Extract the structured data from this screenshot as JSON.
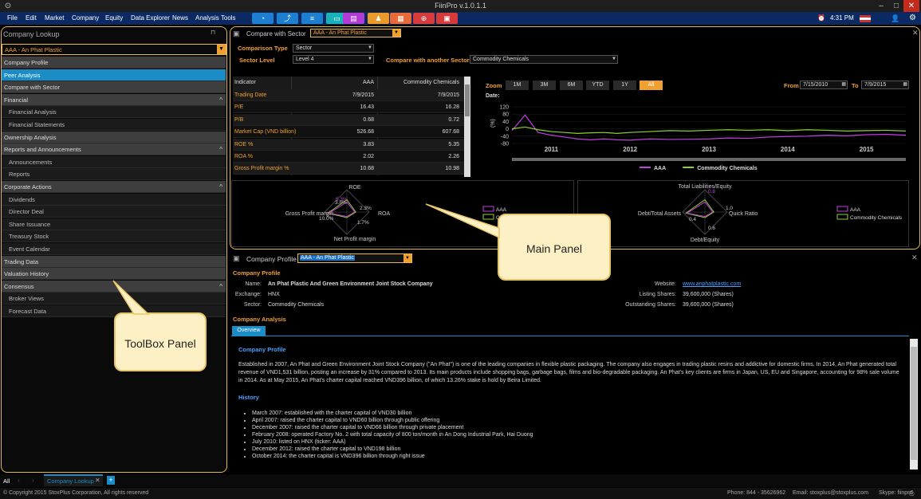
{
  "window": {
    "title": "FiinPro v.1.0.1.1",
    "time": "4:31 PM"
  },
  "menu": [
    "File",
    "Edit",
    "Market",
    "Company",
    "Equity",
    "Data Explorer",
    "News",
    "Analysis Tools"
  ],
  "toolbar_icons": [
    "dashboard-icon",
    "chart-icon",
    "screener-icon",
    "monitor-icon",
    "report-icon",
    "group-icon",
    "presentation-icon",
    "help-icon",
    "calendar-icon"
  ],
  "toolbox": {
    "title": "Company Lookup",
    "selected": "AAA - An Phat Plastic",
    "items": [
      {
        "label": "Company Profile",
        "kind": "cat"
      },
      {
        "label": "Peer Analysis",
        "kind": "active"
      },
      {
        "label": "Compare with Sector",
        "kind": "cat"
      },
      {
        "label": "Financial",
        "kind": "cat",
        "chev": "^"
      },
      {
        "label": "Financial Analysis",
        "kind": "sub"
      },
      {
        "label": "Financial Statements",
        "kind": "sub"
      },
      {
        "label": "Ownership Analysis",
        "kind": "cat"
      },
      {
        "label": "Reports and Announcements",
        "kind": "cat",
        "chev": "^"
      },
      {
        "label": "Announcements",
        "kind": "sub"
      },
      {
        "label": "Reports",
        "kind": "sub"
      },
      {
        "label": "Corporate Actions",
        "kind": "cat",
        "chev": "^"
      },
      {
        "label": "Dividends",
        "kind": "sub"
      },
      {
        "label": "Director Deal",
        "kind": "sub"
      },
      {
        "label": "Share Issuance",
        "kind": "sub"
      },
      {
        "label": "Treasury Stock",
        "kind": "sub"
      },
      {
        "label": "Event Calendar",
        "kind": "sub"
      },
      {
        "label": "Trading Data",
        "kind": "cat"
      },
      {
        "label": "Valuation History",
        "kind": "cat"
      },
      {
        "label": "Consensus",
        "kind": "cat",
        "chev": "^"
      },
      {
        "label": "Broker Views",
        "kind": "sub"
      },
      {
        "label": "Forecast Data",
        "kind": "sub"
      }
    ]
  },
  "compare": {
    "title": "Compare with Sector",
    "selected": "AAA - An Phat Plastic",
    "comparison_type_label": "Comparison Type",
    "comparison_type": "Sector",
    "sector_level_label": "Sector Level",
    "sector_level": "Level 4",
    "compare_another_label": "Compare with another Sector",
    "compare_another": "Commodity Chemicals",
    "table_headers": [
      "Indicator",
      "AAA",
      "Commodity Chemicals"
    ],
    "table_rows": [
      [
        "Trading Date",
        "7/9/2015",
        "7/9/2015"
      ],
      [
        "P/E",
        "16.43",
        "16.28"
      ],
      [
        "P/B",
        "0.68",
        "0.72"
      ],
      [
        "Market Cap (VND billion)",
        "526.68",
        "607.68"
      ],
      [
        "ROE %",
        "3.83",
        "5.35"
      ],
      [
        "ROA %",
        "2.02",
        "2.26"
      ],
      [
        "Gross Profit margin %",
        "10.68",
        "10.98"
      ]
    ]
  },
  "chart_data": [
    {
      "type": "line",
      "zoom_label": "Zoom",
      "zoom_options": [
        "1M",
        "3M",
        "6M",
        "YTD",
        "1Y",
        "All"
      ],
      "zoom_selected": "All",
      "date_label": "Date:",
      "from_label": "From",
      "from": "7/15/2010",
      "to_label": "To",
      "to": "7/9/2015",
      "ylabel": "(%)",
      "yticks": [
        120,
        80,
        40,
        0,
        -40,
        -80
      ],
      "ylim": [
        -80,
        120
      ],
      "xticks": [
        "2011",
        "2012",
        "2013",
        "2014",
        "2015"
      ],
      "legend": "bottom",
      "series": [
        {
          "name": "AAA",
          "color": "#c040e0",
          "x": [
            "2010-07",
            "2010-09",
            "2010-11",
            "2011-01",
            "2011-03",
            "2011-05",
            "2011-07",
            "2011-09",
            "2011-11",
            "2012-01",
            "2012-04",
            "2012-07",
            "2012-10",
            "2013-01",
            "2013-04",
            "2013-07",
            "2013-10",
            "2014-01",
            "2014-04",
            "2014-07",
            "2014-10",
            "2015-01",
            "2015-04",
            "2015-07"
          ],
          "values": [
            -10,
            75,
            -20,
            -35,
            -45,
            -55,
            -60,
            -55,
            -60,
            -62,
            -55,
            -58,
            -57,
            -55,
            -50,
            -52,
            -45,
            -42,
            -40,
            -35,
            -38,
            -32,
            -30,
            -35
          ]
        },
        {
          "name": "Commodity Chemicals",
          "color": "#90d030",
          "x": [
            "2010-07",
            "2010-09",
            "2010-11",
            "2011-01",
            "2011-03",
            "2011-05",
            "2011-07",
            "2011-09",
            "2011-11",
            "2012-01",
            "2012-04",
            "2012-07",
            "2012-10",
            "2013-01",
            "2013-04",
            "2013-07",
            "2013-10",
            "2014-01",
            "2014-04",
            "2014-07",
            "2014-10",
            "2015-01",
            "2015-04",
            "2015-07"
          ],
          "values": [
            0,
            10,
            -5,
            -15,
            -20,
            -25,
            -22,
            -20,
            -25,
            -20,
            -15,
            -10,
            -12,
            -8,
            -5,
            -8,
            -5,
            -10,
            -5,
            -8,
            -12,
            -10,
            -8,
            -12
          ]
        }
      ]
    },
    {
      "type": "radar",
      "axes": [
        "ROE",
        "ROA",
        "Net Profit margin",
        "Gross Profit margin"
      ],
      "labels_aaa": [
        "3.8%",
        "2.3%",
        "1.7%",
        "10.0%"
      ],
      "label_top": "5.3%",
      "series": [
        {
          "name": "AAA",
          "color": "#c040e0"
        },
        {
          "name": "Commodity Chemicals",
          "color": "#90d030"
        }
      ]
    },
    {
      "type": "radar",
      "axes": [
        "Total Liabilities/Equity",
        "Quick Ratio",
        "Debt/Equity",
        "Debt/Total Assets"
      ],
      "ticks": [
        "0.8",
        "1.0",
        "0.6",
        "0.4"
      ],
      "series": [
        {
          "name": "AAA",
          "color": "#c040e0"
        },
        {
          "name": "Commodity Chemicals",
          "color": "#90d030"
        }
      ]
    }
  ],
  "profile": {
    "title": "Company Profile",
    "selected": "AAA - An Phat Plastic",
    "section": "Company Profile",
    "name_label": "Name:",
    "name": "An Phat Plastic And Green Environment Joint Stock Company",
    "exchange_label": "Exchange:",
    "exchange": "HNX",
    "sector_label": "Sector:",
    "sector": "Commodity Chemicals",
    "website_label": "Website:",
    "website": "www.anphatplastic.com",
    "listing_label": "Listing Shares:",
    "listing": "39,600,000 (Shares)",
    "outstanding_label": "Outstanding Shares:",
    "outstanding": "39,600,000 (Shares)",
    "analysis_label": "Company Analysis",
    "tab": "Overview",
    "profile_head": "Company Profile",
    "profile_text": "Established in 2007, An Phat and Green Environment Joint Stock Company (\"An Phat\") is one of the leading companies in flexible plastic packaging. The company also engages in trading plastic resins and addictive for domestic firms. In 2014, An Phat generated total revenue of VND1,531 billion, posting an increase by 31% compared to 2013. Its main products include shopping bags, garbage bags, films and bio-degradable packaging. An Phat's key clients are firms in Japan, US, EU and Singapore, accounting for 98% sale volume in 2014. As at May 2015, An Phat's charter capital reached VND396 billion, of which 13.26% stake is hold by Beira Limited.",
    "history_head": "History",
    "history": [
      "March 2007: established with the charter capital of VND30 billion",
      "April 2007: raised the charter capital to VND60 billion through public offering",
      "December 2007: raised the charter capital to VND66 billion through private placement",
      "February 2008: operated Factory No. 2 with total capacity of 800 ton/month in An Dong Industrial Park, Hai Duong",
      "July 2010: listed on HNX (ticker: AAA)",
      "December 2012: raised the charter capital to VND198 billion",
      "October 2014: the charter capital is VND396 billion through right issue"
    ]
  },
  "callouts": {
    "main": "Main Panel",
    "toolbox": "ToolBox Panel"
  },
  "tabs": {
    "all": "All",
    "open": "Company Lookup"
  },
  "status": {
    "copyright": "© Copyright 2015 StoxPlus Corporation, All rights reserved",
    "phone": "Phone: 844 - 35626962",
    "email": "Email: stoxplus@stoxplus.com",
    "skype": "Skype: fiinpro"
  }
}
